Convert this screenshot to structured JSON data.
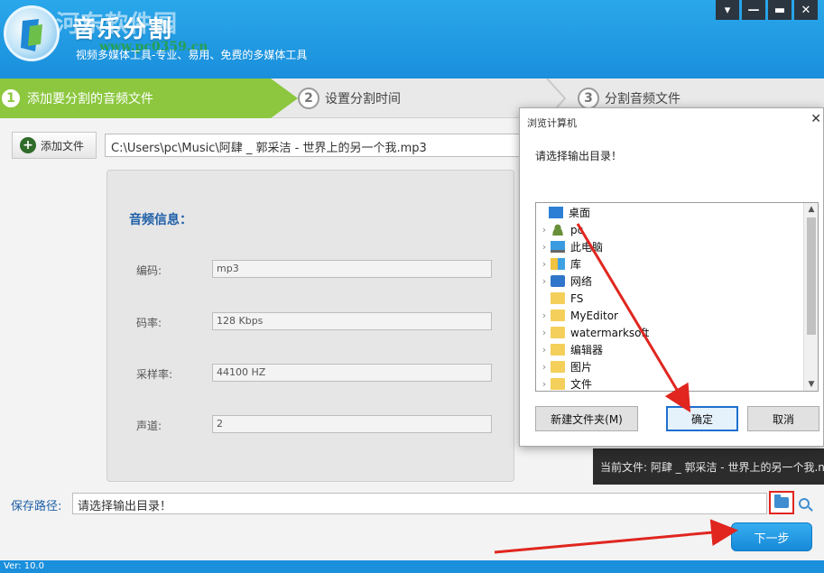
{
  "app": {
    "title": "音乐分割",
    "subtitle": "视频多媒体工具-专业、易用、免费的多媒体工具",
    "watermark": "河东软件园",
    "watermark_url": "www.pc0359.cn",
    "version": "Ver: 10.0"
  },
  "window_controls": [
    "▾",
    "—",
    "▬",
    "✕"
  ],
  "steps": [
    {
      "num": "1",
      "label": "添加要分割的音频文件"
    },
    {
      "num": "2",
      "label": "设置分割时间"
    },
    {
      "num": "3",
      "label": "分割音频文件"
    }
  ],
  "file": {
    "add_label": "添加文件",
    "path": "C:\\Users\\pc\\Music\\阿肆 _ 郭采洁 - 世界上的另一个我.mp3"
  },
  "audio_info": {
    "title": "音频信息：",
    "fields": [
      {
        "label": "编码:",
        "value": "mp3"
      },
      {
        "label": "码率:",
        "value": "128 Kbps"
      },
      {
        "label": "采样率:",
        "value": "44100 HZ"
      },
      {
        "label": "声道:",
        "value": "2"
      }
    ]
  },
  "current_file": "当前文件: 阿肆 _ 郭采洁 - 世界上的另一个我.n",
  "save": {
    "label": "保存路径:",
    "placeholder": "请选择输出目录！"
  },
  "next_label": "下一步",
  "dialog": {
    "title": "浏览计算机",
    "close": "✕",
    "prompt": "请选择输出目录！",
    "tree": [
      {
        "label": "桌面",
        "icon": "desktop-icon",
        "indent": 0,
        "arrow": ""
      },
      {
        "label": "pc",
        "icon": "user-icon",
        "indent": 1,
        "arrow": "›"
      },
      {
        "label": "此电脑",
        "icon": "computer-icon",
        "indent": 1,
        "arrow": "›"
      },
      {
        "label": "库",
        "icon": "library-icon",
        "indent": 1,
        "arrow": "›"
      },
      {
        "label": "网络",
        "icon": "network-icon",
        "indent": 1,
        "arrow": "›"
      },
      {
        "label": "FS",
        "icon": "folder-icon",
        "indent": 1,
        "arrow": ""
      },
      {
        "label": "MyEditor",
        "icon": "folder-icon",
        "indent": 1,
        "arrow": "›"
      },
      {
        "label": "watermarksoft",
        "icon": "folder-icon",
        "indent": 1,
        "arrow": "›"
      },
      {
        "label": "编辑器",
        "icon": "folder-icon",
        "indent": 1,
        "arrow": "›"
      },
      {
        "label": "图片",
        "icon": "folder-icon",
        "indent": 1,
        "arrow": "›"
      },
      {
        "label": "文件",
        "icon": "folder-icon",
        "indent": 1,
        "arrow": "›"
      }
    ],
    "new_folder": "新建文件夹(M)",
    "ok": "确定",
    "cancel": "取消"
  },
  "colors": {
    "header": "#1a8fdc",
    "step_active": "#8cc73f",
    "highlight": "#e0261f"
  }
}
